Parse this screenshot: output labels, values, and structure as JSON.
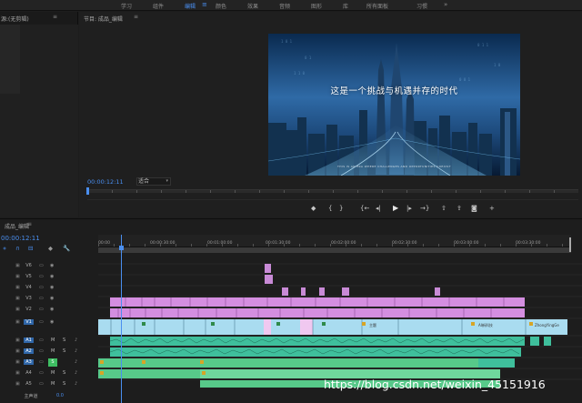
{
  "workspaces": {
    "items": [
      "学习",
      "组件",
      "编辑",
      "颜色",
      "效果",
      "音频",
      "图形",
      "库",
      "所有面板",
      "习惯"
    ],
    "active_index": 2,
    "active_menu_icon": "≡",
    "overflow_icon": "»"
  },
  "source_panel": {
    "title": "源:(无剪辑)",
    "menu_icon": "≡"
  },
  "program_panel": {
    "title": "节目: 成品_编辑",
    "menu_icon": "≡",
    "video_caption": "这是一个挑战与机遇并存的时代",
    "video_subcaption": "THIS IS AN ERA WHERE CHALLENGES AND OPPORTUNITIES COEXIST",
    "timecode": "00:00:12:11",
    "fit_value": "适合",
    "fit_caret": "▾"
  },
  "transport": [
    {
      "name": "add-marker-button",
      "glyph": "◆"
    },
    {
      "name": "mark-in-button",
      "glyph": "{"
    },
    {
      "name": "mark-out-button",
      "glyph": "}"
    },
    {
      "name": "go-to-in-button",
      "glyph": "{←"
    },
    {
      "name": "step-back-button",
      "glyph": "◂|"
    },
    {
      "name": "play-button",
      "glyph": "▶"
    },
    {
      "name": "step-forward-button",
      "glyph": "|▸"
    },
    {
      "name": "go-to-out-button",
      "glyph": "→}"
    },
    {
      "name": "lift-button",
      "glyph": "⇧"
    },
    {
      "name": "extract-button",
      "glyph": "⇪"
    },
    {
      "name": "export-frame-button",
      "glyph": "◙"
    },
    {
      "name": "button-editor-button",
      "glyph": "+"
    }
  ],
  "timeline": {
    "title": "成品_编辑",
    "menu_icon": "≡",
    "timecode": "00:00:12:11",
    "ruler_labels": [
      "00:00",
      "00:00:30:00",
      "00:01:00:00",
      "00:01:30:00",
      "00:02:00:00",
      "00:02:30:00",
      "00:03:00:00",
      "00:03:30:00"
    ],
    "tools": [
      "⋄",
      "∩",
      "⊟",
      "◆",
      "🔧"
    ],
    "video_tracks": [
      "V6",
      "V5",
      "V4",
      "V3",
      "V2",
      "V1"
    ],
    "audio_tracks": [
      "A1",
      "A2",
      "A3",
      "A4",
      "A5"
    ],
    "master_label": "主声道",
    "master_value": "0.0",
    "track_m": "M",
    "track_s": "S",
    "lock_icon": "🔒",
    "clip_labels": {
      "v1_a": "主题",
      "v1_b": "AI新科技",
      "v1_c": "ZhongYingGe"
    }
  },
  "watermark": "https://blog.csdn.net/weixin_45151916",
  "colors": {
    "accent_blue": "#4a8ff0",
    "video_clip_pink": "#d48ee0",
    "video_clip_blue": "#a9dcf0",
    "audio_clip_teal": "#3fbf9c",
    "audio_clip_green": "#57c989",
    "mute_green": "#3ebe63"
  }
}
